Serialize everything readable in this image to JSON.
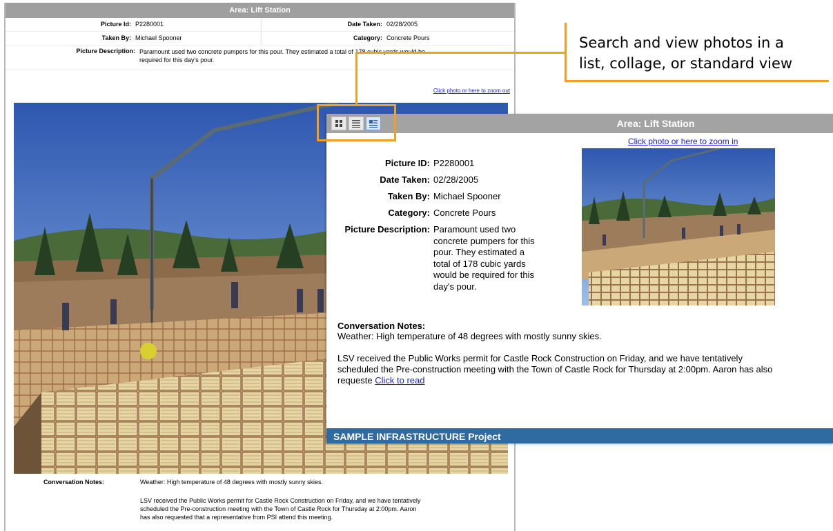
{
  "back": {
    "area_title": "Area: Lift Station",
    "picture_id_label": "Picture Id:",
    "picture_id": "P2280001",
    "date_taken_label": "Date Taken:",
    "date_taken": "02/28/2005",
    "taken_by_label": "Taken By:",
    "taken_by": "Michael Spooner",
    "category_label": "Category:",
    "category": "Concrete Pours",
    "description_label": "Picture Description:",
    "description_line1": "Paramount used two concrete pumpers for this pour. They estimated a total of 178 cubic yards would be",
    "description_line2": "required for this day's pour.",
    "zoom_out_link": "Click photo or here to zoom out",
    "notes_label": "Conversation Notes:",
    "notes_line1": "Weather: High temperature of 48 degrees with mostly sunny skies.",
    "notes_para2_l1": "LSV received the Public Works permit for Castle Rock Construction on Friday, and we have tentatively",
    "notes_para2_l2": "scheduled the Pre-construction meeting with the Town of Castle Rock for Thursday at 2:00pm. Aaron",
    "notes_para2_l3": "has also requested that a representative from PSI attend this meeting."
  },
  "callout": {
    "line1": "Search and view photos in a",
    "line2": "list, collage, or standard view",
    "accent": "#f3a020"
  },
  "view_toolbar": {
    "buttons": [
      "collage-view-icon",
      "list-view-icon",
      "standard-view-icon"
    ],
    "active": "standard-view-icon"
  },
  "front": {
    "area_title": "Area: Lift Station",
    "zoom_in_link": "Click photo or here to zoom in",
    "picture_id_label": "Picture ID:",
    "picture_id": "P2280001",
    "date_taken_label": "Date Taken:",
    "date_taken": "02/28/2005",
    "taken_by_label": "Taken By:",
    "taken_by": "Michael Spooner",
    "category_label": "Category:",
    "category": "Concrete Pours",
    "description_label": "Picture Description:",
    "desc_l1": "Paramount used two",
    "desc_l2": "concrete pumpers for this",
    "desc_l3": "pour. They estimated a",
    "desc_l4": "total of 178 cubic yards",
    "desc_l5": "would be required for this",
    "desc_l6": "day's pour.",
    "notes_label": "Conversation Notes:",
    "notes_line1": "Weather: High temperature of 48 degrees with mostly sunny skies.",
    "notes_p2_l1": "LSV received the Public Works permit for Castle Rock Construction on Friday, and we have tentatively",
    "notes_p2_l2": "scheduled the Pre-construction meeting with the Town of Castle Rock for Thursday at 2:00pm. Aaron has also",
    "notes_p2_l3": "requeste",
    "read_link": "Click to read",
    "footer_project": "SAMPLE INFRASTRUCTURE Project",
    "footer_color": "#2f6aa0"
  }
}
